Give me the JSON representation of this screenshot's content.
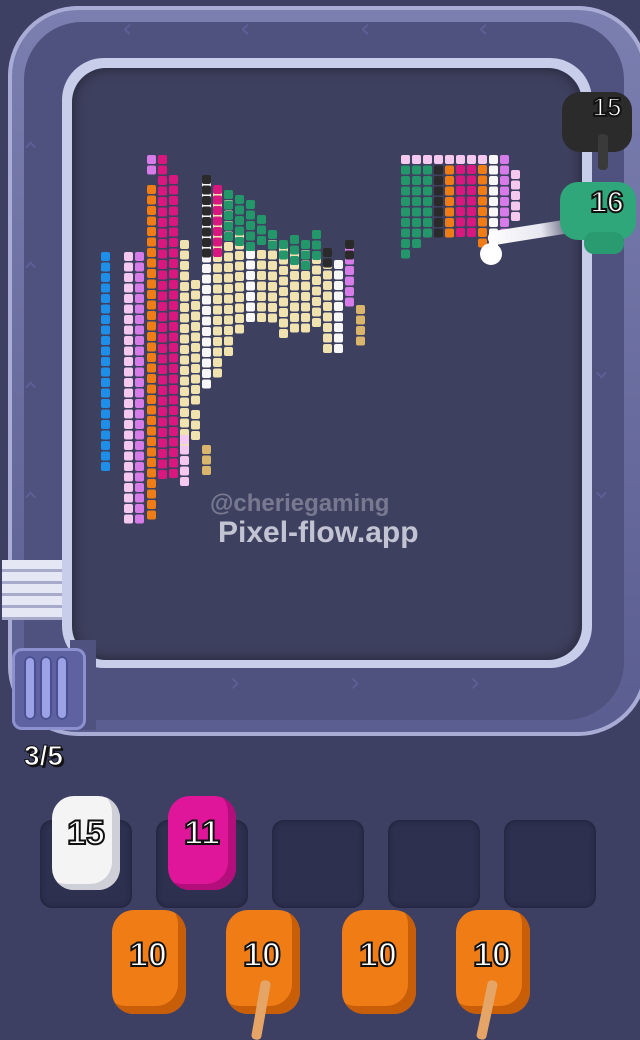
{
  "game": {
    "watermark_handle": "@cheriegaming",
    "watermark_site": "Pixel-flow.app",
    "queue_count": "3/5"
  },
  "track_shooters": [
    {
      "label": "15",
      "color": "#2b2b2b"
    },
    {
      "label": "16",
      "color": "#2fa77a"
    }
  ],
  "holding_slots": [
    {
      "label": "15",
      "color": "#f4f4f4",
      "filled": true
    },
    {
      "label": "11",
      "color": "#e0169a",
      "filled": true
    },
    {
      "label": "",
      "color": "",
      "filled": false
    },
    {
      "label": "",
      "color": "",
      "filled": false
    },
    {
      "label": "",
      "color": "",
      "filled": false
    }
  ],
  "deck": [
    {
      "label": "10",
      "color": "#f07c16"
    },
    {
      "label": "10",
      "color": "#f07c16"
    },
    {
      "label": "10",
      "color": "#f07c16"
    },
    {
      "label": "10",
      "color": "#f07c16"
    }
  ],
  "palette": {
    "blue": "#1e8fe8",
    "violet": "#d77be8",
    "pink": "#f5c8f0",
    "magenta": "#d8177f",
    "orange": "#f07c16",
    "cream": "#f0e3b0",
    "white": "#f7f7f7",
    "black": "#2a2a2a",
    "green": "#23976a",
    "tan": "#d9b66b"
  }
}
